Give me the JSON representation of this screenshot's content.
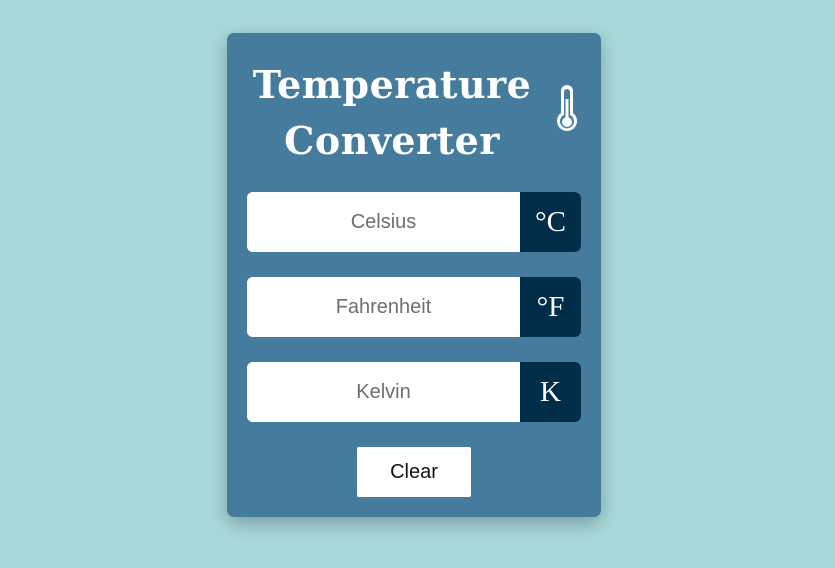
{
  "app": {
    "title_line1": "Temperature",
    "title_line2": "Converter",
    "icon": "thermometer-icon",
    "colors": {
      "background": "#a8d9da",
      "card": "#457b9d",
      "unit_badge": "#002d47",
      "text_light": "#ffffff"
    }
  },
  "fields": {
    "celsius": {
      "placeholder": "Celsius",
      "value": "",
      "unit": "°C"
    },
    "fahrenheit": {
      "placeholder": "Fahrenheit",
      "value": "",
      "unit": "°F"
    },
    "kelvin": {
      "placeholder": "Kelvin",
      "value": "",
      "unit": "K"
    }
  },
  "actions": {
    "clear_label": "Clear"
  }
}
